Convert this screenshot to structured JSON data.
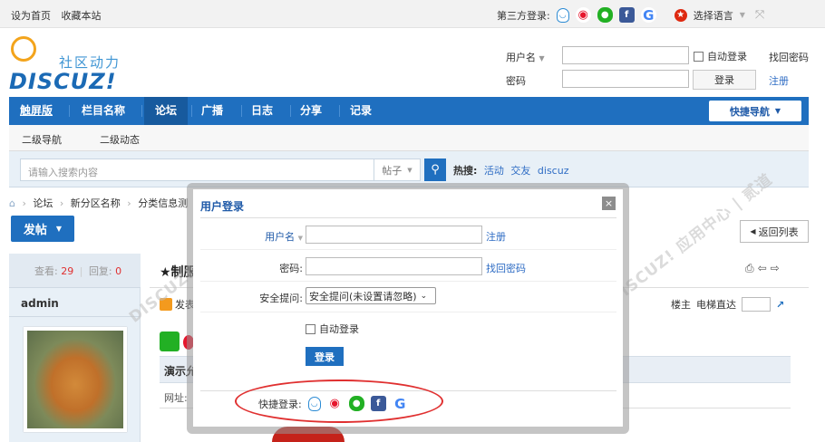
{
  "topbar": {
    "set_home": "设为首页",
    "bookmark": "收藏本站",
    "third_party_label": "第三方登录:",
    "lang": "选择语言"
  },
  "header": {
    "logo_tag": "社区动力",
    "logo_text": "DISCUZ!",
    "username_label": "用户名",
    "password_label": "密码",
    "auto_login": "自动登录",
    "find_password": "找回密码",
    "login_button": "登录",
    "register": "注册"
  },
  "nav": {
    "items": [
      "触屏版",
      "栏目名称",
      "论坛",
      "广播",
      "日志",
      "分享",
      "记录"
    ],
    "quick_nav": "快捷导航"
  },
  "subnav": {
    "items": [
      "二级导航",
      "二级动态"
    ]
  },
  "search": {
    "placeholder": "请输入搜索内容",
    "type": "帖子",
    "hot_label": "热搜:",
    "hot": [
      "活动",
      "交友",
      "discuz"
    ]
  },
  "breadcrumb": [
    "论坛",
    "新分区名称",
    "分类信息测"
  ],
  "post_button": "发帖",
  "back_list": "返回列表",
  "thread": {
    "views_label": "查看:",
    "views": "29",
    "replies_label": "回复:",
    "replies": "0",
    "title": "★制服",
    "author": "admin",
    "publish_label": "发表",
    "floor_owner": "楼主",
    "elevator": "电梯直达",
    "demo": "演示允",
    "url_label": "网址:"
  },
  "modal": {
    "title": "用户登录",
    "close": "×",
    "username_label": "用户名",
    "register": "注册",
    "password_label": "密码:",
    "find_password": "找回密码",
    "security_label": "安全提问:",
    "security_value": "安全提问(未设置请忽略)",
    "auto_login": "自动登录",
    "login_button": "登录",
    "quick_login_label": "快捷登录:"
  },
  "colors": {
    "accent": "#1f6fbf",
    "link": "#2e6cc4",
    "highlight": "#e03030"
  }
}
